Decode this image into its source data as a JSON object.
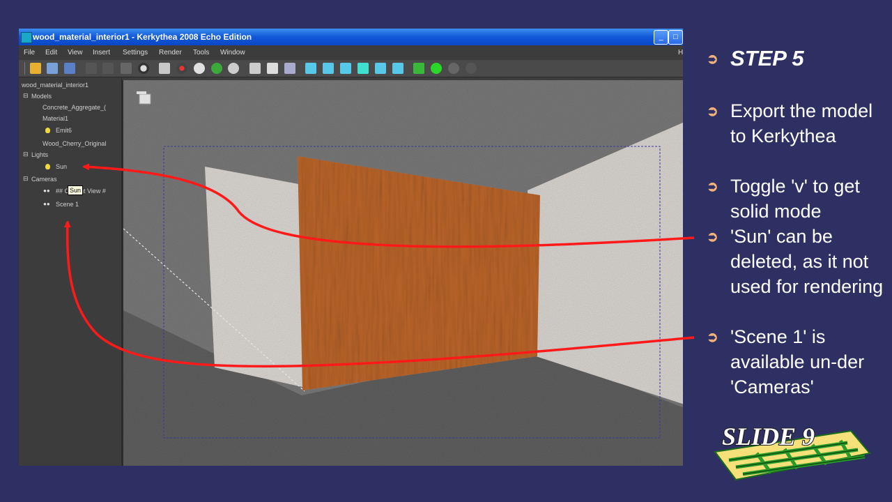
{
  "window": {
    "title": "wood_material_interior1 - Kerkythea 2008 Echo Edition",
    "min_button": "_",
    "max_button": "□"
  },
  "menu": [
    "File",
    "Edit",
    "View",
    "Insert",
    "Settings",
    "Render",
    "Tools",
    "Window"
  ],
  "menu_help": "H",
  "toolbar_icons": [
    "open-icon",
    "save-icon",
    "save-as-icon",
    "undo-icon",
    "redo-icon",
    "magic-wand-icon",
    "contrast-icon",
    "select-icon",
    "target-icon",
    "pan-icon",
    "rotate-icon",
    "zoom-icon",
    "home-icon",
    "camera-icon",
    "camera-move-icon",
    "view-front-icon",
    "view-back-icon",
    "view-left-icon",
    "view-right-icon",
    "view-top-icon",
    "view-bottom-icon",
    "render-icon",
    "start-render-icon",
    "settings-icon",
    "stop-icon"
  ],
  "scene_tree": {
    "root": "wood_material_interior1",
    "models_label": "Models",
    "models": [
      "Concrete_Aggregate_(",
      "Material1",
      "Emit6",
      "Wood_Cherry_Original"
    ],
    "lights_label": "Lights",
    "lights": [
      "Sun"
    ],
    "cameras_label": "Cameras",
    "cameras": [
      "## Current View #",
      "Scene 1"
    ],
    "expand_symbol": "⊟",
    "tooltip": "Sun"
  },
  "slide": {
    "step_title": "STEP 5",
    "bullet_symbol": "➲",
    "bullets": [
      "Export the model to Kerkythea",
      "Toggle 'v' to get solid mode",
      "'Sun' can be deleted, as it not used for rendering",
      "'Scene 1' is available un-der 'Cameras'"
    ],
    "logo_text": "SLIDE 9"
  },
  "colors": {
    "background": "#2e3063",
    "annotation_arrow": "#ff1a1a",
    "bullet": "#f0b27a",
    "wood": "#b8642a"
  }
}
